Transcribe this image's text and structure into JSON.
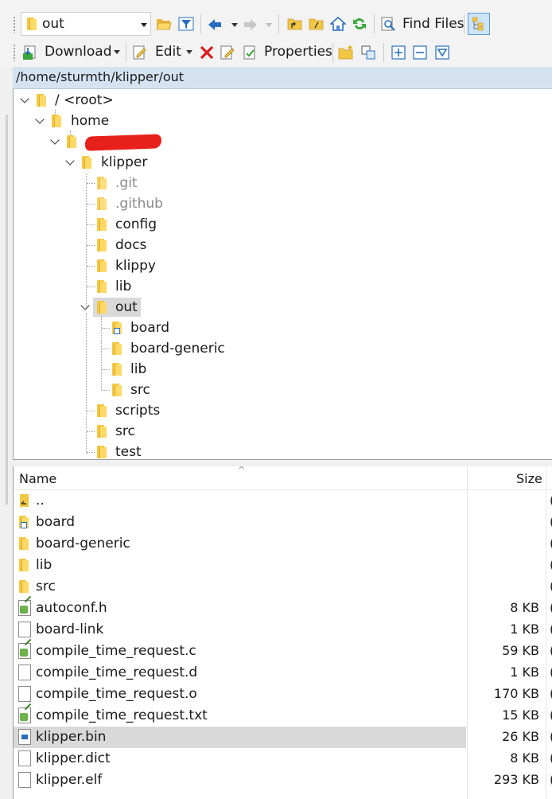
{
  "toolbar1": {
    "path_combo_value": "out",
    "find_files_label": "Find Files"
  },
  "toolbar2": {
    "download_label": "Download",
    "edit_label": "Edit",
    "properties_label": "Properties"
  },
  "path_bar": "/home/sturmth/klipper/out",
  "tree": {
    "root": "/ <root>",
    "home": "home",
    "klipper": "klipper",
    "children": [
      ".git",
      ".github",
      "config",
      "docs",
      "klippy",
      "lib",
      "out"
    ],
    "out_children": [
      "board",
      "board-generic",
      "lib",
      "src"
    ],
    "after": [
      "scripts",
      "src",
      "test"
    ]
  },
  "list": {
    "col_name": "Name",
    "col_size": "Size",
    "rows": [
      {
        "name": "..",
        "size": ""
      },
      {
        "name": "board",
        "size": ""
      },
      {
        "name": "board-generic",
        "size": ""
      },
      {
        "name": "lib",
        "size": ""
      },
      {
        "name": "src",
        "size": ""
      },
      {
        "name": "autoconf.h",
        "size": "8 KB"
      },
      {
        "name": "board-link",
        "size": "1 KB"
      },
      {
        "name": "compile_time_request.c",
        "size": "59 KB"
      },
      {
        "name": "compile_time_request.d",
        "size": "1 KB"
      },
      {
        "name": "compile_time_request.o",
        "size": "170 KB"
      },
      {
        "name": "compile_time_request.txt",
        "size": "15 KB"
      },
      {
        "name": "klipper.bin",
        "size": "26 KB"
      },
      {
        "name": "klipper.dict",
        "size": "8 KB"
      },
      {
        "name": "klipper.elf",
        "size": "293 KB"
      }
    ]
  }
}
